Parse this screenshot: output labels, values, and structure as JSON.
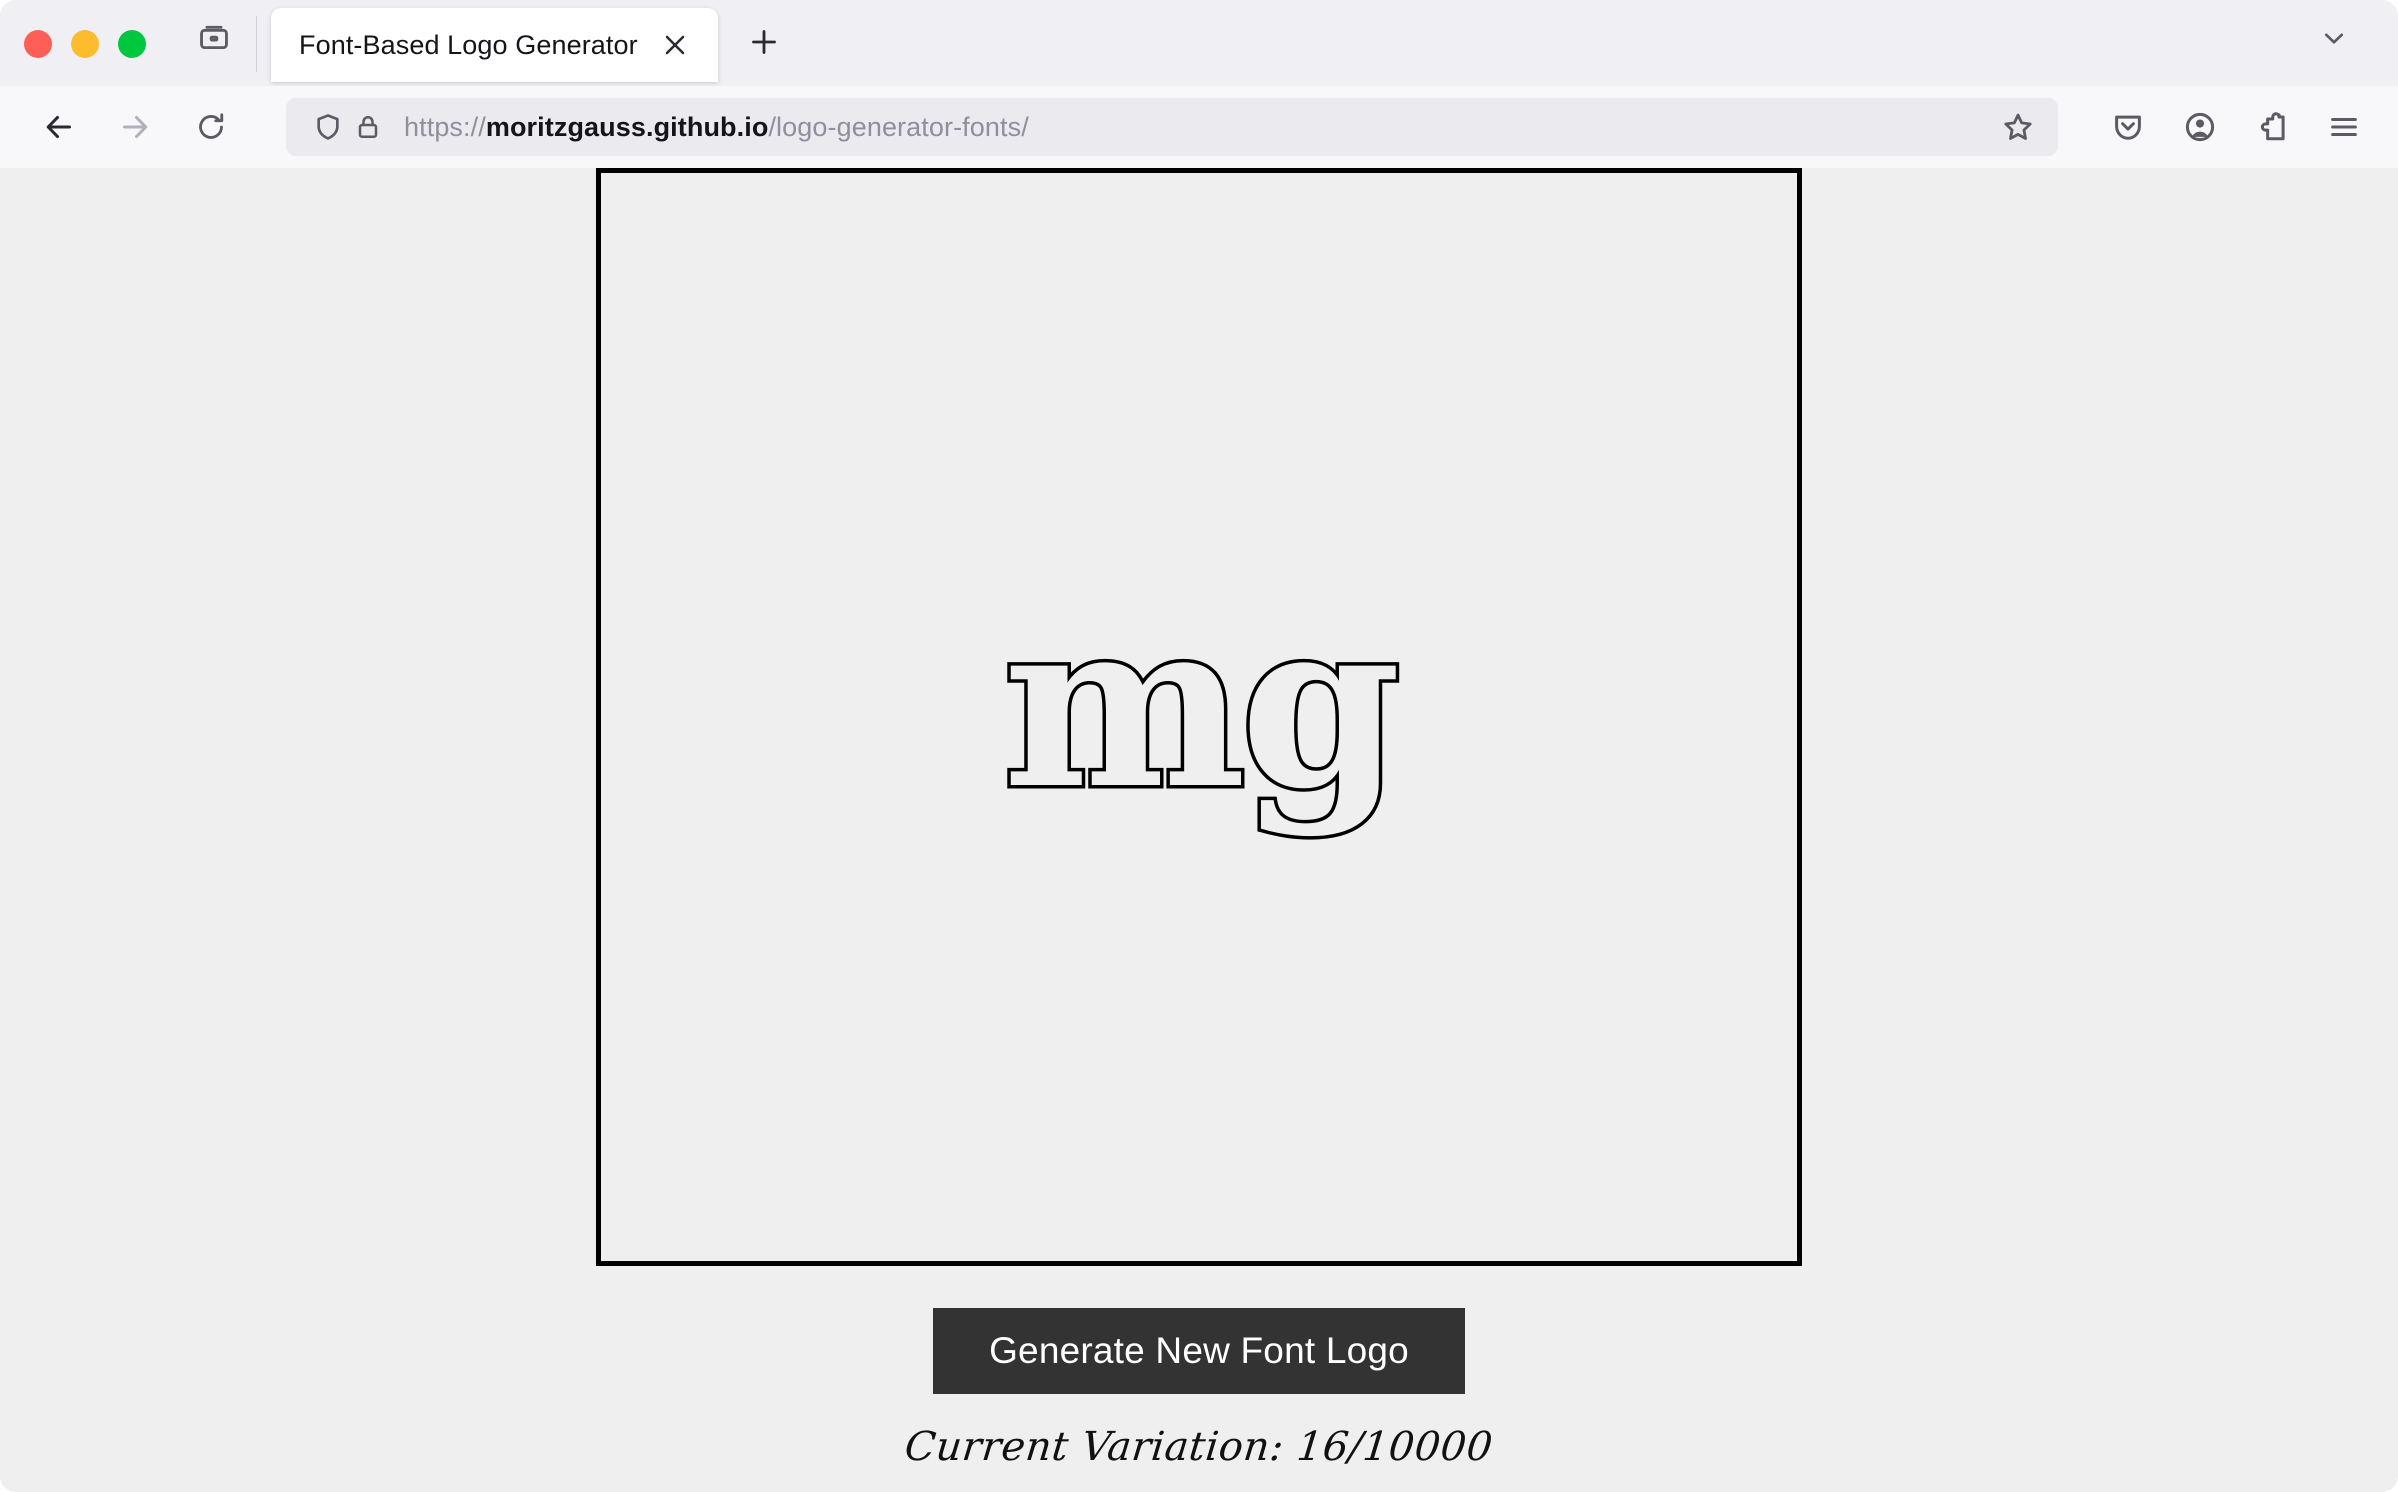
{
  "window": {
    "traffic_lights": [
      {
        "name": "close",
        "color": "#ff5f57"
      },
      {
        "name": "minimize",
        "color": "#fdbc2e"
      },
      {
        "name": "maximize",
        "color": "#00c73e"
      }
    ]
  },
  "tabstrip": {
    "firefox_view_icon": "firefox-view-icon",
    "tabs": [
      {
        "title": "Font-Based Logo Generator",
        "active": true,
        "close_icon": "close-icon"
      }
    ],
    "new_tab_icon": "plus-icon",
    "all_tabs_icon": "chevron-down-icon"
  },
  "navbar": {
    "back_icon": "arrow-left-icon",
    "forward_icon": "arrow-right-icon",
    "reload_icon": "reload-icon",
    "shield_icon": "shield-icon",
    "lock_icon": "lock-icon",
    "url": {
      "scheme": "https://",
      "host": "moritzgauss.github.io",
      "path": "/logo-generator-fonts/",
      "full": "https://moritzgauss.github.io/logo-generator-fonts/"
    },
    "bookmark_icon": "star-icon",
    "toolbar_icons": [
      "pocket-save-icon",
      "account-icon",
      "extensions-puzzle-icon",
      "app-menu-hamburger-icon"
    ]
  },
  "page": {
    "logo": {
      "text": "mg",
      "style": "outlined-serif",
      "fill_color": "#efefef",
      "stroke_color": "#000000"
    },
    "canvas": {
      "border_color": "#000000",
      "background": "#efefef"
    },
    "generate_button": {
      "label": "Generate New Font Logo",
      "background": "#333333",
      "text_color": "#ffffff"
    },
    "variation_status": "Current Variation: 16/10000",
    "background_color": "#efefef"
  }
}
